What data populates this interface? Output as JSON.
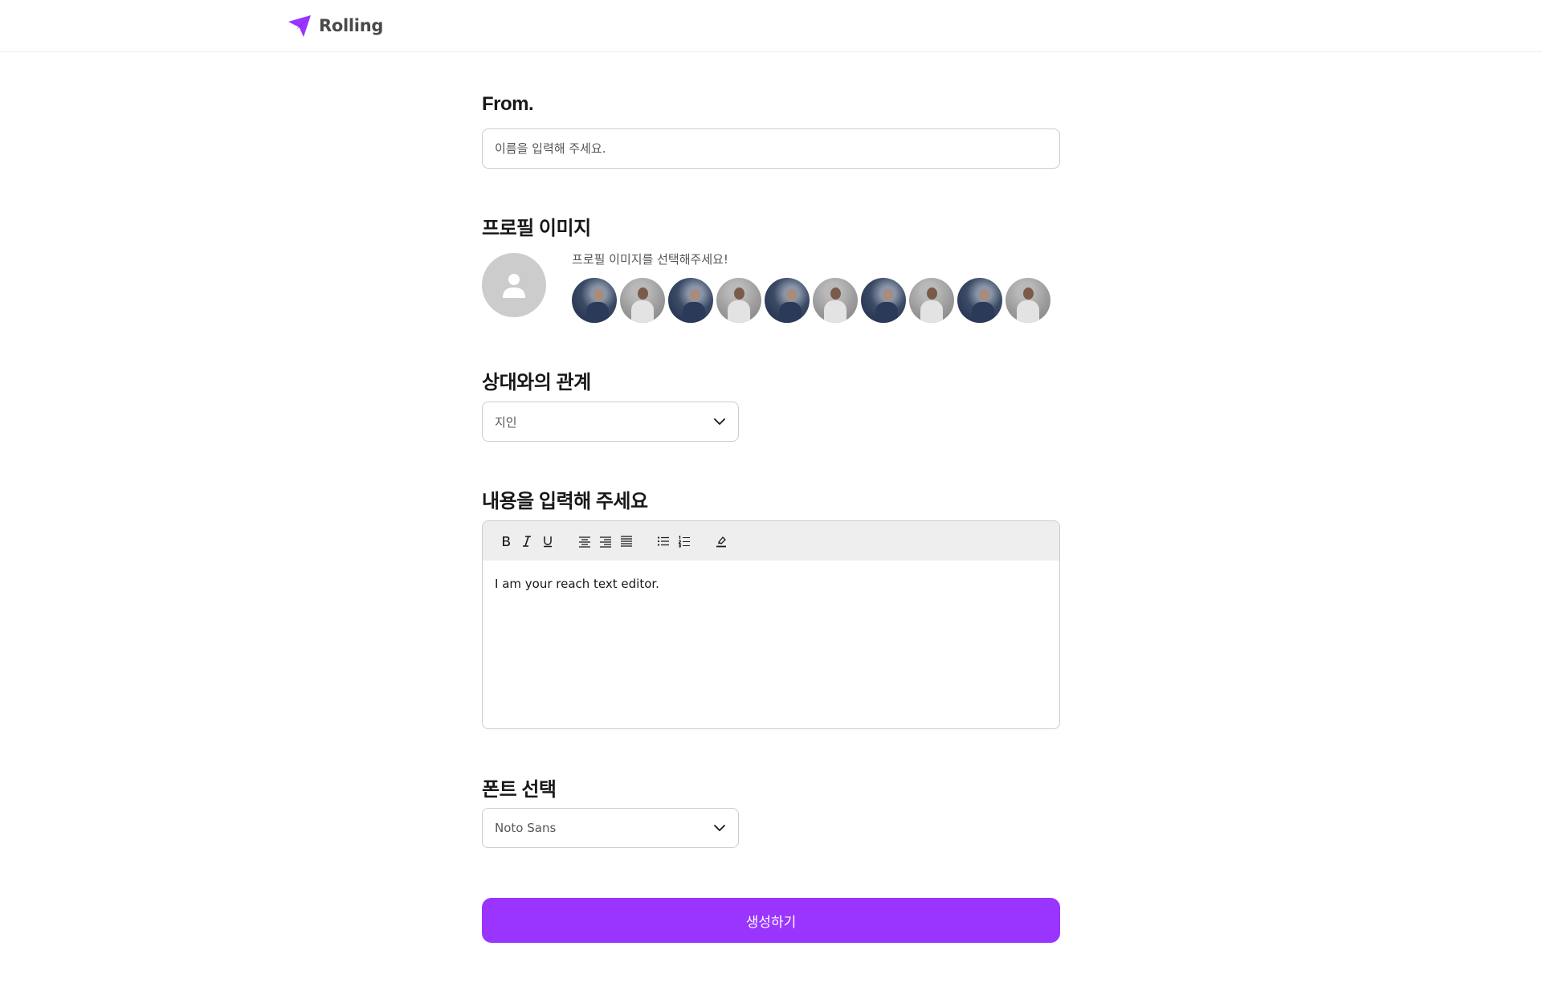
{
  "header": {
    "brand_name": "Rolling",
    "logo_icon": "paper-plane-icon",
    "accent_color": "#9935ff"
  },
  "from": {
    "label": "From.",
    "placeholder": "이름을 입력해 주세요.",
    "value": ""
  },
  "profile": {
    "label": "프로필 이미지",
    "hint": "프로필 이미지를 선택해주세요!",
    "default_icon": "person-icon",
    "options": [
      {
        "style": "dark"
      },
      {
        "style": "light"
      },
      {
        "style": "dark"
      },
      {
        "style": "light"
      },
      {
        "style": "dark"
      },
      {
        "style": "light"
      },
      {
        "style": "dark"
      },
      {
        "style": "light"
      },
      {
        "style": "dark"
      },
      {
        "style": "light"
      }
    ]
  },
  "relationship": {
    "label": "상대와의 관계",
    "selected": "지인"
  },
  "content": {
    "label": "내용을 입력해 주세요",
    "toolbar_icons": [
      "bold-icon",
      "italic-icon",
      "underline-icon",
      "align-center-icon",
      "align-right-icon",
      "align-justify-icon",
      "bulleted-list-icon",
      "numbered-list-icon",
      "highlighter-icon"
    ],
    "body_text": "I am your reach text editor."
  },
  "font": {
    "label": "폰트 선택",
    "selected": "Noto Sans"
  },
  "submit": {
    "label": "생성하기"
  }
}
